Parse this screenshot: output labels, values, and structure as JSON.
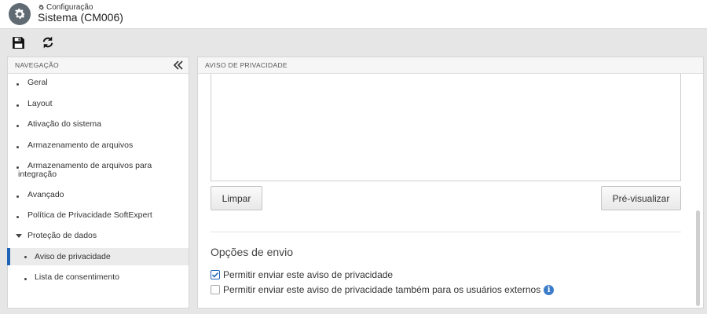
{
  "header": {
    "breadcrumb": "Configuração",
    "title": "Sistema (CM006)"
  },
  "toolbar": {
    "save_icon": "save-icon",
    "refresh_icon": "refresh-icon"
  },
  "nav": {
    "heading": "NAVEGAÇÃO",
    "items": [
      {
        "label": "Geral"
      },
      {
        "label": "Layout"
      },
      {
        "label": "Ativação do sistema"
      },
      {
        "label": "Armazenamento de arquivos"
      },
      {
        "label": "Armazenamento de arquivos para integração"
      },
      {
        "label": "Avançado"
      },
      {
        "label": "Política de Privacidade SoftExpert"
      },
      {
        "label": "Proteção de dados"
      },
      {
        "label": "Aviso de privacidade"
      },
      {
        "label": "Lista de consentimento"
      }
    ]
  },
  "main": {
    "heading": "AVISO DE PRIVACIDADE",
    "clear_label": "Limpar",
    "preview_label": "Pré-visualizar",
    "section_title": "Opções de envio",
    "option1_label": "Permitir enviar este aviso de privacidade",
    "option1_checked": true,
    "option2_label": "Permitir enviar este aviso de privacidade também para os usuários externos",
    "option2_checked": false,
    "info_glyph": "i"
  },
  "colors": {
    "accent": "#1f63b5",
    "icon_bg": "#5f6a72",
    "info": "#3a7cc9"
  }
}
